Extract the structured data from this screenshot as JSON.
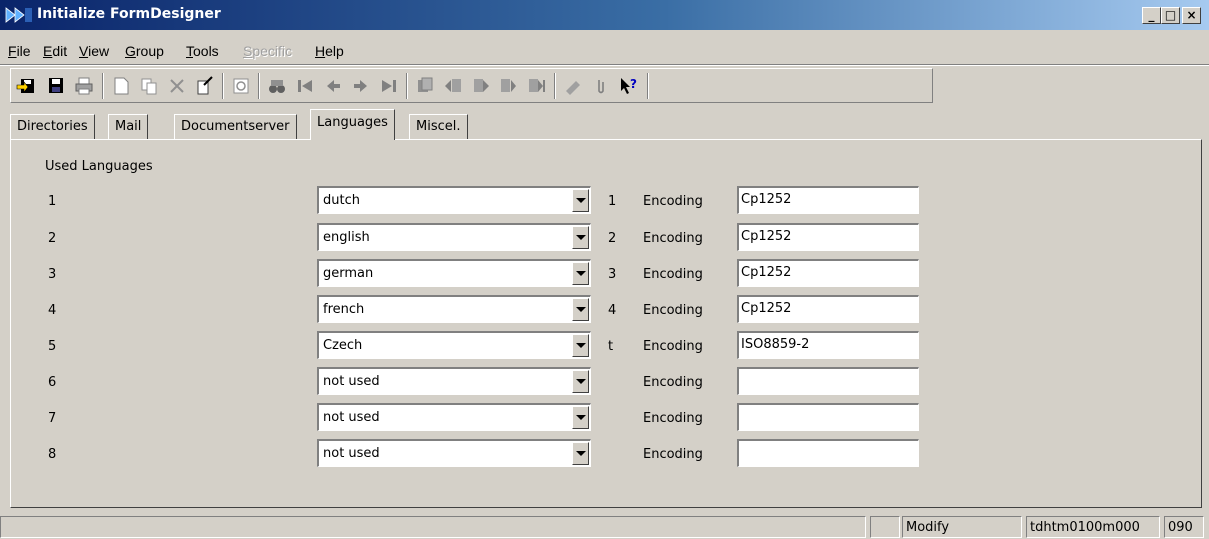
{
  "window": {
    "title": "Initialize FormDesigner",
    "minimize_glyph": "_",
    "maximize_glyph": "□",
    "close_glyph": "×"
  },
  "menu": [
    {
      "label": "File",
      "accel": "F",
      "rest": "ile"
    },
    {
      "label": "Edit",
      "accel": "E",
      "rest": "dit"
    },
    {
      "label": "View",
      "accel": "V",
      "rest": "iew"
    },
    {
      "label": "Group",
      "accel": "G",
      "rest": "roup"
    },
    {
      "label": "Tools",
      "accel": "T",
      "rest": "ools"
    },
    {
      "label": "Specific",
      "accel": "S",
      "rest": "pecific",
      "disabled": true
    },
    {
      "label": "Help",
      "accel": "H",
      "rest": "elp"
    }
  ],
  "toolbar_icons": [
    "exit-icon",
    "save-icon",
    "print-icon",
    "new-document-icon",
    "copy-icon",
    "delete-icon",
    "edit-icon",
    "refresh-icon",
    "find-icon",
    "first-record-icon",
    "previous-record-icon",
    "next-record-icon",
    "last-record-icon",
    "group-first-icon",
    "group-previous-icon",
    "group-next-icon",
    "group-last-icon",
    "bookmark-icon",
    "attachment-icon",
    "help-pointer-icon"
  ],
  "tabs": [
    {
      "label": "Directories"
    },
    {
      "label": "Mail"
    },
    {
      "label": "Documentserver"
    },
    {
      "label": "Languages",
      "active": true
    },
    {
      "label": "Miscel."
    }
  ],
  "section_title": "Used Languages",
  "encoding_label": "Encoding",
  "languages": [
    {
      "index": "1",
      "language": "dutch",
      "code": "1",
      "encoding": "Cp1252"
    },
    {
      "index": "2",
      "language": "english",
      "code": "2",
      "encoding": "Cp1252"
    },
    {
      "index": "3",
      "language": "german",
      "code": "3",
      "encoding": "Cp1252"
    },
    {
      "index": "4",
      "language": "french",
      "code": "4",
      "encoding": "Cp1252"
    },
    {
      "index": "5",
      "language": "Czech",
      "code": "t",
      "encoding": "ISO8859-2"
    },
    {
      "index": "6",
      "language": "not used",
      "code": "",
      "encoding": ""
    },
    {
      "index": "7",
      "language": "not used",
      "code": "",
      "encoding": ""
    },
    {
      "index": "8",
      "language": "not used",
      "code": "",
      "encoding": ""
    }
  ],
  "status": {
    "blank": "",
    "mode": "Modify",
    "session": "tdhtm0100m000",
    "company": "090"
  }
}
